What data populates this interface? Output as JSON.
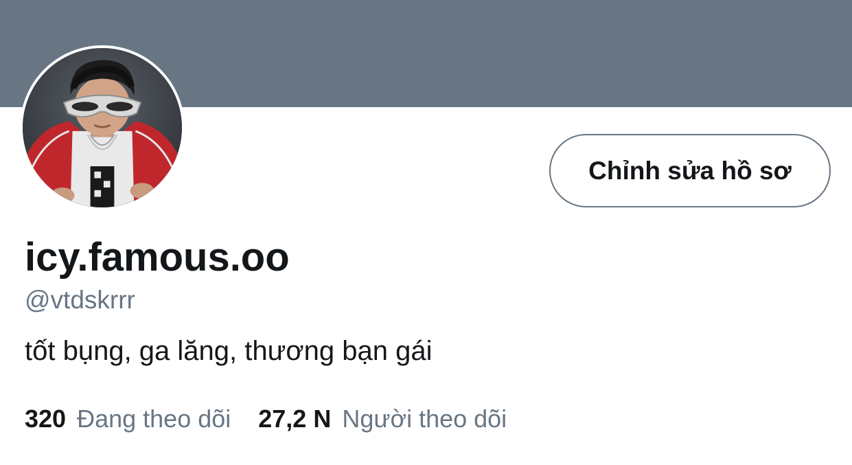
{
  "profile": {
    "display_name": "icy.famous.oo",
    "handle": "@vtdskrrr",
    "bio": "tốt bụng, ga lăng, thương bạn gái"
  },
  "actions": {
    "edit_profile_label": "Chỉnh sửa hồ sơ"
  },
  "stats": {
    "following_count": "320",
    "following_label": "Đang theo dõi",
    "followers_count": "27,2 N",
    "followers_label": "Người theo dõi"
  },
  "colors": {
    "banner": "#687684",
    "text_primary": "#14171a",
    "text_secondary": "#687684",
    "button_border": "#687684"
  }
}
